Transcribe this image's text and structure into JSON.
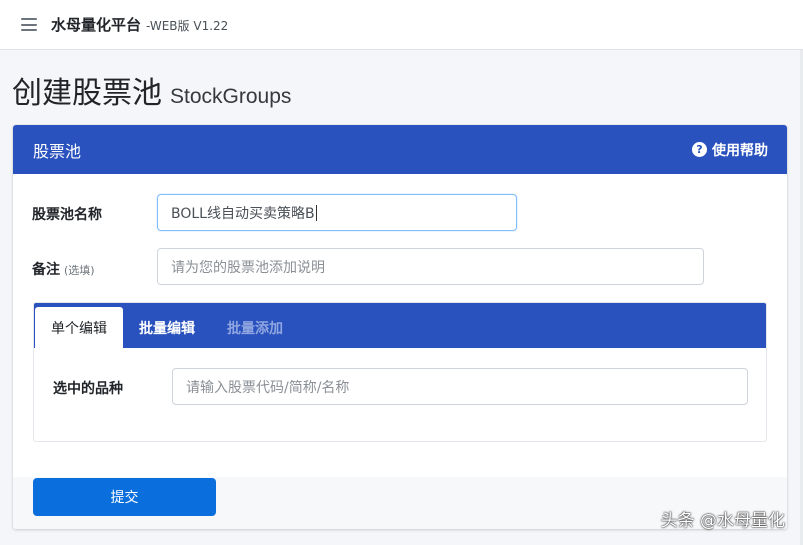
{
  "topbar": {
    "brand_name": "水母量化平台",
    "brand_version": "-WEB版 V1.22",
    "menu_icon": "hamburger-menu-icon"
  },
  "page": {
    "title": "创建股票池",
    "title_en": "StockGroups"
  },
  "card": {
    "title": "股票池",
    "help_label": "使用帮助",
    "help_icon": "question-circle-icon",
    "header_color": "#2a52be"
  },
  "form": {
    "name_label": "股票池名称",
    "name_value": "BOLL线自动买卖策略B",
    "note_label": "备注",
    "note_optional": "(选填)",
    "note_placeholder": "请为您的股票池添加说明"
  },
  "tabs": {
    "items": [
      {
        "label": "单个编辑",
        "state": "active"
      },
      {
        "label": "批量编辑",
        "state": "normal"
      },
      {
        "label": "批量添加",
        "state": "disabled"
      }
    ],
    "selected_label": "选中的品种",
    "selected_placeholder": "请输入股票代码/简称/名称"
  },
  "actions": {
    "submit_label": "提交",
    "submit_color": "#0a6fdc"
  },
  "watermark": {
    "text": "头条 @水母量化"
  }
}
